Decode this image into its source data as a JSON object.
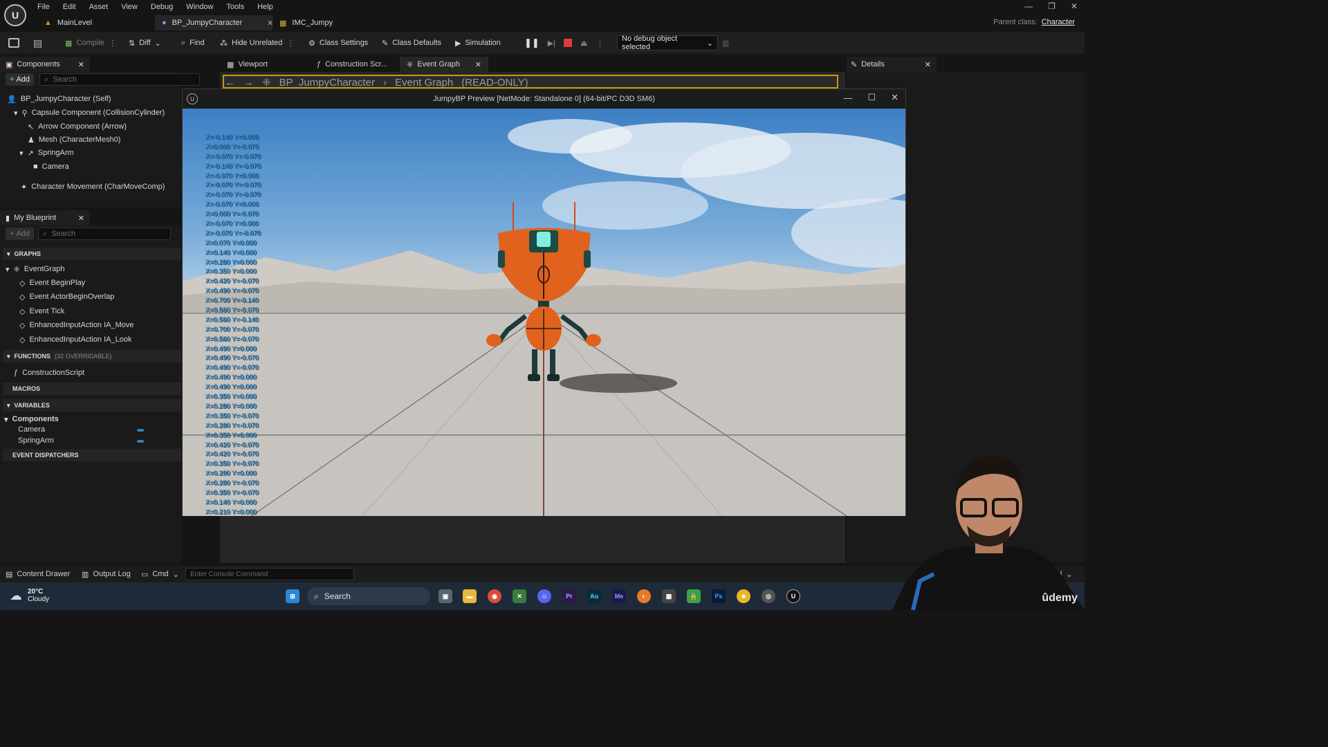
{
  "menu": [
    "File",
    "Edit",
    "Asset",
    "View",
    "Debug",
    "Window",
    "Tools",
    "Help"
  ],
  "doc_tabs": [
    "MainLevel",
    "BP_JumpyCharacter",
    "IMC_Jumpy"
  ],
  "parent_class": {
    "label": "Parent class:",
    "value": "Character"
  },
  "toolbar": {
    "compile": "Compile",
    "diff": "Diff",
    "find": "Find",
    "hide_unrelated": "Hide Unrelated",
    "class_settings": "Class Settings",
    "class_defaults": "Class Defaults",
    "simulation": "Simulation",
    "debug_object": "No debug object selected"
  },
  "components_panel": {
    "title": "Components",
    "add": "Add",
    "search_placeholder": "Search",
    "items": [
      "BP_JumpyCharacter (Self)",
      "Capsule Component (CollisionCylinder)",
      "Arrow Component (Arrow)",
      "Mesh (CharacterMesh0)",
      "SpringArm",
      "Camera",
      "Character Movement (CharMoveComp)"
    ]
  },
  "my_blueprint": {
    "title": "My Blueprint",
    "add": "Add",
    "search_placeholder": "Search",
    "graphs_label": "GRAPHS",
    "event_graph": "EventGraph",
    "events": [
      "Event BeginPlay",
      "Event ActorBeginOverlap",
      "Event Tick",
      "EnhancedInputAction IA_Move",
      "EnhancedInputAction IA_Look"
    ],
    "functions_label": "FUNCTIONS",
    "functions_sub": "(32 OVERRIDABLE)",
    "functions": [
      "ConstructionScript"
    ],
    "macros_label": "MACROS",
    "variables_label": "VARIABLES",
    "components_label": "Components",
    "variables": [
      "Camera",
      "SpringArm"
    ],
    "dispatchers_label": "EVENT DISPATCHERS"
  },
  "editor_tabs": [
    "Viewport",
    "Construction Scr...",
    "Event Graph"
  ],
  "graph_crumb": {
    "bp": "BP_JumpyCharacter",
    "graph": "Event Graph",
    "mode": "(READ-ONLY)"
  },
  "details": {
    "title": "Details"
  },
  "preview": {
    "title": "JumpyBP Preview [NetMode: Standalone 0]  (64-bit/PC D3D SM6)",
    "debug_lines": [
      "X=-0.140 Y=0.000",
      "X=0.000 Y=-0.070",
      "X=-0.070 Y=-0.070",
      "X=-0.140 Y=-0.070",
      "X=-0.070 Y=0.000",
      "X=-0.070 Y=-0.070",
      "X=-0.070 Y=-0.070",
      "X=-0.070 Y=0.000",
      "X=0.000 Y=-0.070",
      "X=-0.070 Y=0.000",
      "X=-0.070 Y=-0.070",
      "X=0.070 Y=0.000",
      "X=0.140 Y=0.000",
      "X=0.280 Y=0.000",
      "X=0.350 Y=0.000",
      "X=0.420 Y=-0.070",
      "X=0.490 Y=-0.070",
      "X=0.700 Y=-0.140",
      "X=0.560 Y=-0.070",
      "X=0.560 Y=-0.140",
      "X=0.700 Y=-0.070",
      "X=0.560 Y=-0.070",
      "X=0.490 Y=0.000",
      "X=0.490 Y=-0.070",
      "X=0.490 Y=-0.070",
      "X=0.490 Y=0.000",
      "X=0.490 Y=0.000",
      "X=0.350 Y=0.000",
      "X=0.280 Y=0.000",
      "X=0.350 Y=-0.070",
      "X=0.280 Y=-0.070",
      "X=0.350 Y=0.000",
      "X=0.420 Y=-0.070",
      "X=0.420 Y=-0.070",
      "X=0.350 Y=-0.070",
      "X=0.280 Y=0.000",
      "X=0.280 Y=-0.070",
      "X=0.350 Y=-0.070",
      "X=0.140 Y=0.000",
      "X=0.210 Y=0.000"
    ]
  },
  "bottom_bar": {
    "content_drawer": "Content Drawer",
    "output_log": "Output Log",
    "cmd": "Cmd",
    "console_placeholder": "Enter Console Command",
    "trol": "trol"
  },
  "taskbar": {
    "temp": "20°C",
    "weather": "Cloudy",
    "search": "Search",
    "apps": [
      "Pr",
      "Au",
      "Me",
      "Ps"
    ]
  },
  "watermark": "ûdemy",
  "colors": {
    "accent_orange": "#c49c10",
    "debug_text": "#33aaff",
    "robot": "#e0621c"
  }
}
